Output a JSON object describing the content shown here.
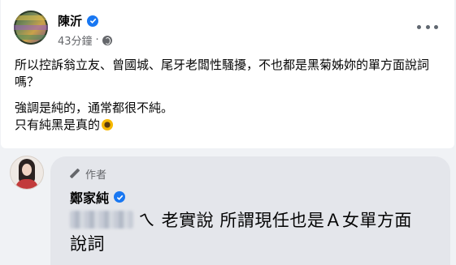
{
  "post": {
    "author": "陳沂",
    "timestamp": "43分鐘",
    "separator": "·",
    "privacy_icon": "globe-icon",
    "menu_icon": "more-options-icon",
    "lines": [
      "所以控訴翁立友、曾國城、尾牙老闆性騷擾，不也都是黑菊姊妳的單方面說詞嗎？",
      "強調是純的，通常都很不純。",
      "只有純黑是真的"
    ],
    "emoji": "sunflower-emoji"
  },
  "comment": {
    "author_tag": "作者",
    "commenter": "鄭家純",
    "text_after_mention": "ㄟ 老實說 所謂現任也是Ａ女單方面說詞"
  },
  "colors": {
    "verified": "#1877f2",
    "meta_text": "#65676b",
    "bubble": "#e4e6eb",
    "page_bg": "#f0f2f5"
  }
}
